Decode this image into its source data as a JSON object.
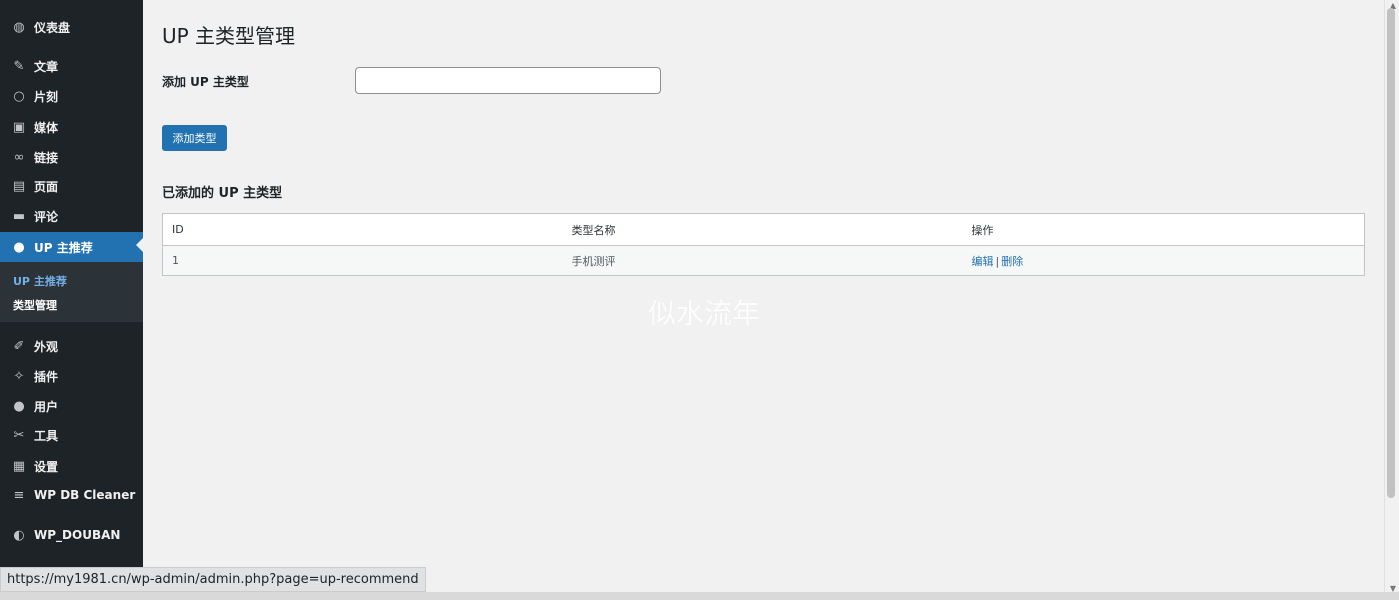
{
  "sidebar": {
    "items": [
      {
        "label": "仪表盘",
        "icon": "dashboard-icon",
        "glyph": "◍"
      },
      {
        "label": "文章",
        "icon": "pin-icon",
        "glyph": "✎"
      },
      {
        "label": "片刻",
        "icon": "circle-icon",
        "glyph": "○"
      },
      {
        "label": "媒体",
        "icon": "media-icon",
        "glyph": "▣"
      },
      {
        "label": "链接",
        "icon": "link-icon",
        "glyph": "∞"
      },
      {
        "label": "页面",
        "icon": "pages-icon",
        "glyph": "▤"
      },
      {
        "label": "评论",
        "icon": "comment-icon",
        "glyph": "▬"
      },
      {
        "label": "UP 主推荐",
        "icon": "user-icon",
        "glyph": "●"
      },
      {
        "label": "外观",
        "icon": "appearance-icon",
        "glyph": "✐"
      },
      {
        "label": "插件",
        "icon": "plugin-icon",
        "glyph": "✧"
      },
      {
        "label": "用户",
        "icon": "users-icon",
        "glyph": "●"
      },
      {
        "label": "工具",
        "icon": "wrench-icon",
        "glyph": "✂"
      },
      {
        "label": "设置",
        "icon": "settings-icon",
        "glyph": "▦"
      },
      {
        "label": "WP DB Cleaner",
        "icon": "database-icon",
        "glyph": "≡"
      },
      {
        "label": "WP_DOUBAN",
        "icon": "douban-icon",
        "glyph": "◐"
      }
    ],
    "submenu": [
      {
        "label": "UP 主推荐"
      },
      {
        "label": "类型管理"
      }
    ],
    "colors": {
      "bg": "#1d2327",
      "active": "#2271b1",
      "submenu_bg": "#2c3338",
      "sub_inactive": "#72aee6"
    }
  },
  "main": {
    "title": "UP 主类型管理",
    "form": {
      "label": "添加 UP 主类型",
      "input_value": "",
      "button_label": "添加类型"
    },
    "list": {
      "heading": "已添加的 UP 主类型",
      "columns": [
        "ID",
        "类型名称",
        "操作"
      ],
      "rows": [
        {
          "id": "1",
          "name": "手机测评",
          "actions": {
            "edit": "编辑",
            "sep": "|",
            "delete": "删除"
          }
        }
      ]
    }
  },
  "watermark": "似水流年",
  "status_bar_url": "https://my1981.cn/wp-admin/admin.php?page=up-recommend"
}
